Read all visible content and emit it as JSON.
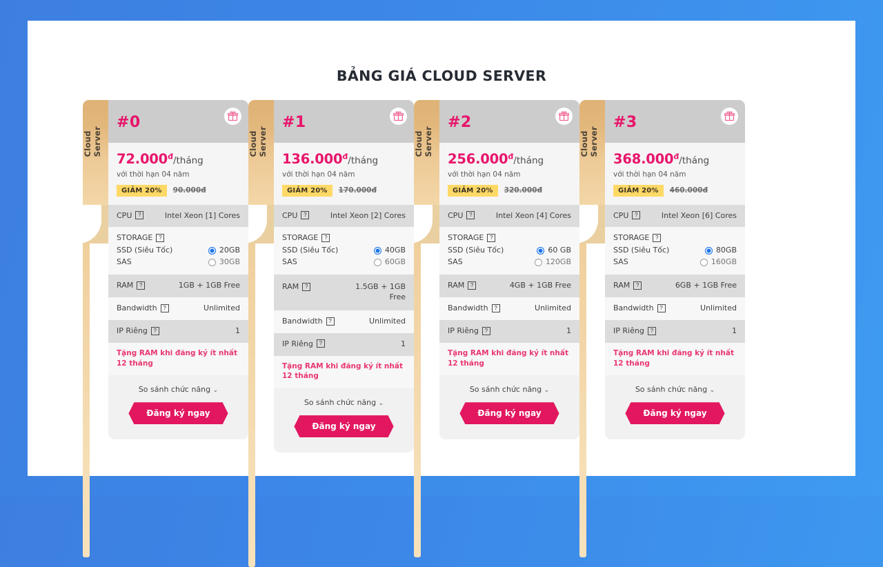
{
  "page": {
    "title": "BẢNG GIÁ CLOUD SERVER",
    "background_color": "#3d7fe0",
    "accent_color": "#e8156b"
  },
  "labels": {
    "tab_text": "Cloud Server",
    "currency_symbol": "đ",
    "per_month": "/tháng",
    "term_note": "với thời hạn 04 năm",
    "discount_badge": "GIẢM 20%",
    "cpu_label": "CPU",
    "storage_label": "STORAGE",
    "ssd_label": "SSD (Siêu Tốc)",
    "sas_label": "SAS",
    "ram_label": "RAM",
    "bandwidth_label": "Bandwidth",
    "ip_label": "IP Riêng",
    "promo_text": "Tặng RAM khi đăng ký ít nhất 12 tháng",
    "compare_label": "So sánh chức năng",
    "cta_label": "Đăng ký ngay",
    "help_glyph": "?",
    "chevron_glyph": "⌄",
    "gift_icon": "gift-icon"
  },
  "plans": [
    {
      "name": "#0",
      "price": "72.000",
      "old_price": "90.000đ",
      "cpu": "Intel Xeon [1] Cores",
      "ssd": "20GB",
      "sas": "30GB",
      "ram": "1GB + 1GB Free",
      "bandwidth": "Unlimited",
      "ip": "1"
    },
    {
      "name": "#1",
      "price": "136.000",
      "old_price": "170.000đ",
      "cpu": "Intel Xeon [2] Cores",
      "ssd": "40GB",
      "sas": "60GB",
      "ram": "1.5GB + 1GB Free",
      "bandwidth": "Unlimited",
      "ip": "1"
    },
    {
      "name": "#2",
      "price": "256.000",
      "old_price": "320.000đ",
      "cpu": "Intel Xeon [4] Cores",
      "ssd": "60 GB",
      "sas": "120GB",
      "ram": "4GB + 1GB Free",
      "bandwidth": "Unlimited",
      "ip": "1"
    },
    {
      "name": "#3",
      "price": "368.000",
      "old_price": "460.000đ",
      "cpu": "Intel Xeon [6] Cores",
      "ssd": "80GB",
      "sas": "160GB",
      "ram": "6GB + 1GB Free",
      "bandwidth": "Unlimited",
      "ip": "1"
    }
  ]
}
